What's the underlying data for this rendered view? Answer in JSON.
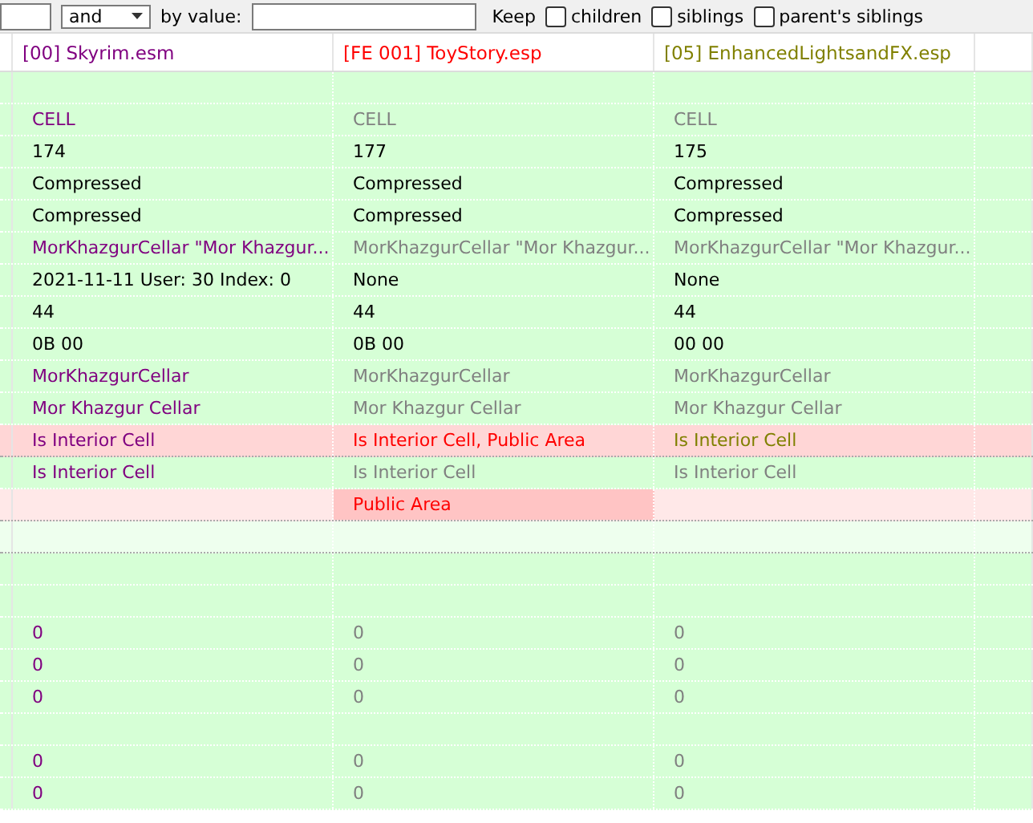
{
  "filter_bar": {
    "operator": "and",
    "value_label": "by value:",
    "keep_label": "Keep",
    "checks": [
      {
        "label": "children",
        "checked": false
      },
      {
        "label": "siblings",
        "checked": false
      },
      {
        "label": "parent's siblings",
        "checked": false
      }
    ]
  },
  "columns": [
    {
      "label": "[00] Skyrim.esm",
      "color": "#800080"
    },
    {
      "label": "[FE 001] ToyStory.esp",
      "color": "#ff0000"
    },
    {
      "label": "[05] EnhancedLightsandFX.esp",
      "color": "#808000"
    }
  ],
  "rows": [
    {
      "conflict": false,
      "dim": false,
      "cells": [
        {
          "kind": "blank"
        },
        {
          "kind": "blank"
        },
        {
          "kind": "blank"
        }
      ]
    },
    {
      "conflict": false,
      "dim": false,
      "cells": [
        {
          "text": "CELL",
          "kind": "master"
        },
        {
          "text": "CELL",
          "kind": "same"
        },
        {
          "text": "CELL",
          "kind": "same"
        }
      ]
    },
    {
      "conflict": false,
      "dim": false,
      "cells": [
        {
          "text": "174",
          "kind": "plain"
        },
        {
          "text": "177",
          "kind": "plain"
        },
        {
          "text": "175",
          "kind": "plain"
        }
      ]
    },
    {
      "conflict": false,
      "dim": false,
      "cells": [
        {
          "text": "Compressed",
          "kind": "plain"
        },
        {
          "text": "Compressed",
          "kind": "plain"
        },
        {
          "text": "Compressed",
          "kind": "plain"
        }
      ]
    },
    {
      "conflict": false,
      "dim": false,
      "cells": [
        {
          "text": "Compressed",
          "kind": "plain"
        },
        {
          "text": "Compressed",
          "kind": "plain"
        },
        {
          "text": "Compressed",
          "kind": "plain"
        }
      ]
    },
    {
      "conflict": false,
      "dim": false,
      "cells": [
        {
          "text": "MorKhazgurCellar \"Mor Khazgur...",
          "kind": "master"
        },
        {
          "text": "MorKhazgurCellar \"Mor Khazgur...",
          "kind": "same"
        },
        {
          "text": "MorKhazgurCellar \"Mor Khazgur...",
          "kind": "same"
        }
      ]
    },
    {
      "conflict": false,
      "dim": false,
      "cells": [
        {
          "text": "2021-11-11 User: 30 Index: 0",
          "kind": "plain"
        },
        {
          "text": "None",
          "kind": "plain"
        },
        {
          "text": "None",
          "kind": "plain"
        }
      ]
    },
    {
      "conflict": false,
      "dim": false,
      "cells": [
        {
          "text": "44",
          "kind": "plain"
        },
        {
          "text": "44",
          "kind": "plain"
        },
        {
          "text": "44",
          "kind": "plain"
        }
      ]
    },
    {
      "conflict": false,
      "dim": false,
      "cells": [
        {
          "text": "0B 00",
          "kind": "plain"
        },
        {
          "text": "0B 00",
          "kind": "plain"
        },
        {
          "text": "00 00",
          "kind": "plain"
        }
      ]
    },
    {
      "conflict": false,
      "dim": false,
      "cells": [
        {
          "text": "MorKhazgurCellar",
          "kind": "master"
        },
        {
          "text": "MorKhazgurCellar",
          "kind": "same"
        },
        {
          "text": "MorKhazgurCellar",
          "kind": "same"
        }
      ]
    },
    {
      "conflict": false,
      "dim": false,
      "cells": [
        {
          "text": "Mor Khazgur Cellar",
          "kind": "master"
        },
        {
          "text": "Mor Khazgur Cellar",
          "kind": "same"
        },
        {
          "text": "Mor Khazgur Cellar",
          "kind": "same"
        }
      ]
    },
    {
      "conflict": true,
      "dim": false,
      "cells": [
        {
          "text": "Is Interior Cell",
          "kind": "master"
        },
        {
          "text": "Is Interior Cell, Public Area",
          "kind": "winner"
        },
        {
          "text": "Is Interior Cell",
          "kind": "loser"
        }
      ]
    },
    {
      "conflict": false,
      "dim": false,
      "cells": [
        {
          "text": "Is Interior Cell",
          "kind": "master"
        },
        {
          "text": "Is Interior Cell",
          "kind": "same"
        },
        {
          "text": "Is Interior Cell",
          "kind": "same"
        }
      ]
    },
    {
      "conflict": true,
      "dim": true,
      "cells": [
        {
          "kind": "blank"
        },
        {
          "text": "Public Area",
          "kind": "winner",
          "highlight": true
        },
        {
          "kind": "blank"
        }
      ]
    },
    {
      "conflict": false,
      "dim": true,
      "cells": [
        {
          "kind": "blank"
        },
        {
          "kind": "blank"
        },
        {
          "kind": "blank"
        }
      ]
    },
    {
      "conflict": false,
      "dim": false,
      "cells": [
        {
          "kind": "blank"
        },
        {
          "kind": "blank"
        },
        {
          "kind": "blank"
        }
      ]
    },
    {
      "conflict": false,
      "dim": false,
      "cells": [
        {
          "kind": "blank"
        },
        {
          "kind": "blank"
        },
        {
          "kind": "blank"
        }
      ]
    },
    {
      "conflict": false,
      "dim": false,
      "cells": [
        {
          "text": "0",
          "kind": "master"
        },
        {
          "text": "0",
          "kind": "same"
        },
        {
          "text": "0",
          "kind": "same"
        }
      ]
    },
    {
      "conflict": false,
      "dim": false,
      "cells": [
        {
          "text": "0",
          "kind": "master"
        },
        {
          "text": "0",
          "kind": "same"
        },
        {
          "text": "0",
          "kind": "same"
        }
      ]
    },
    {
      "conflict": false,
      "dim": false,
      "cells": [
        {
          "text": "0",
          "kind": "master"
        },
        {
          "text": "0",
          "kind": "same"
        },
        {
          "text": "0",
          "kind": "same"
        }
      ]
    },
    {
      "conflict": false,
      "dim": false,
      "cells": [
        {
          "kind": "blank"
        },
        {
          "kind": "blank"
        },
        {
          "kind": "blank"
        }
      ]
    },
    {
      "conflict": false,
      "dim": false,
      "cells": [
        {
          "text": "0",
          "kind": "master"
        },
        {
          "text": "0",
          "kind": "same"
        },
        {
          "text": "0",
          "kind": "same"
        }
      ]
    },
    {
      "conflict": false,
      "dim": false,
      "cells": [
        {
          "text": "0",
          "kind": "master"
        },
        {
          "text": "0",
          "kind": "same"
        },
        {
          "text": "0",
          "kind": "same"
        }
      ]
    }
  ]
}
